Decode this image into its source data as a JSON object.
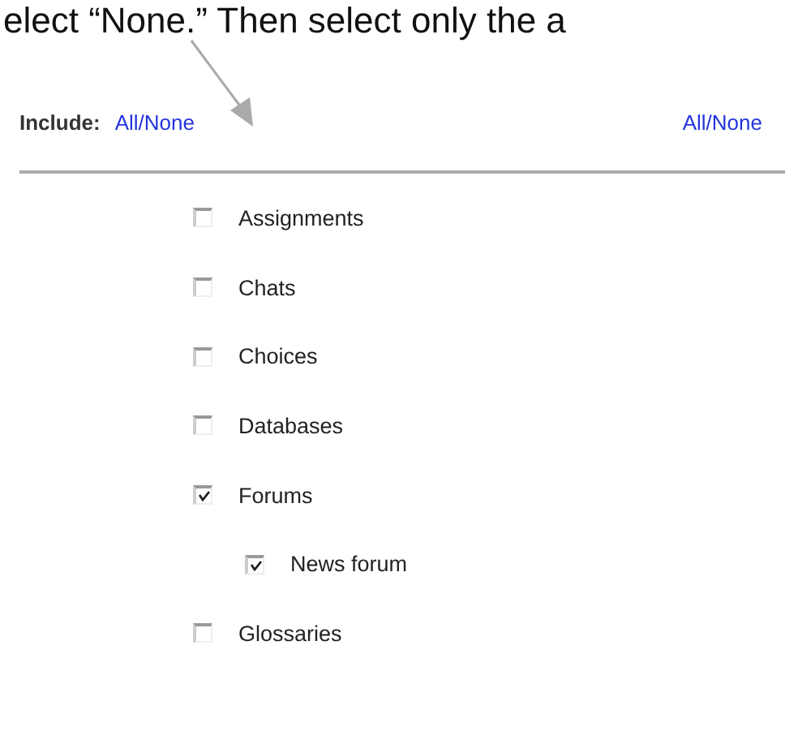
{
  "caption": "elect “None.” Then select only the a",
  "include": {
    "label": "Include:",
    "link": "All/None",
    "right_link": "All/None"
  },
  "items": [
    {
      "label": "Assignments",
      "checked": false
    },
    {
      "label": "Chats",
      "checked": false
    },
    {
      "label": "Choices",
      "checked": false
    },
    {
      "label": "Databases",
      "checked": false
    },
    {
      "label": "Forums",
      "checked": true,
      "children": [
        {
          "label": "News forum",
          "checked": true
        }
      ]
    },
    {
      "label": "Glossaries",
      "checked": false
    }
  ]
}
